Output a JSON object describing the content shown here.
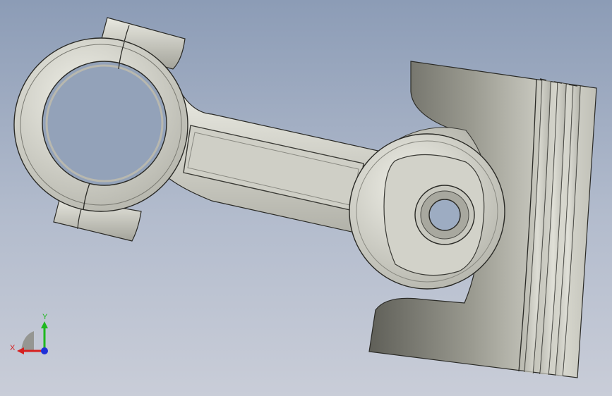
{
  "viewport": {
    "background_top": "#8c9cb6",
    "background_bottom": "#c9cdd8"
  },
  "model": {
    "part": "connecting-rod-and-piston",
    "metal_light": "#e4e4dc",
    "metal_mid": "#c4c4bb",
    "metal_dark": "#6e6e66"
  },
  "triad": {
    "x_label": "X",
    "y_label": "Y",
    "x_color": "#d62020",
    "y_color": "#1fb81f",
    "z_color": "#2030d8"
  }
}
